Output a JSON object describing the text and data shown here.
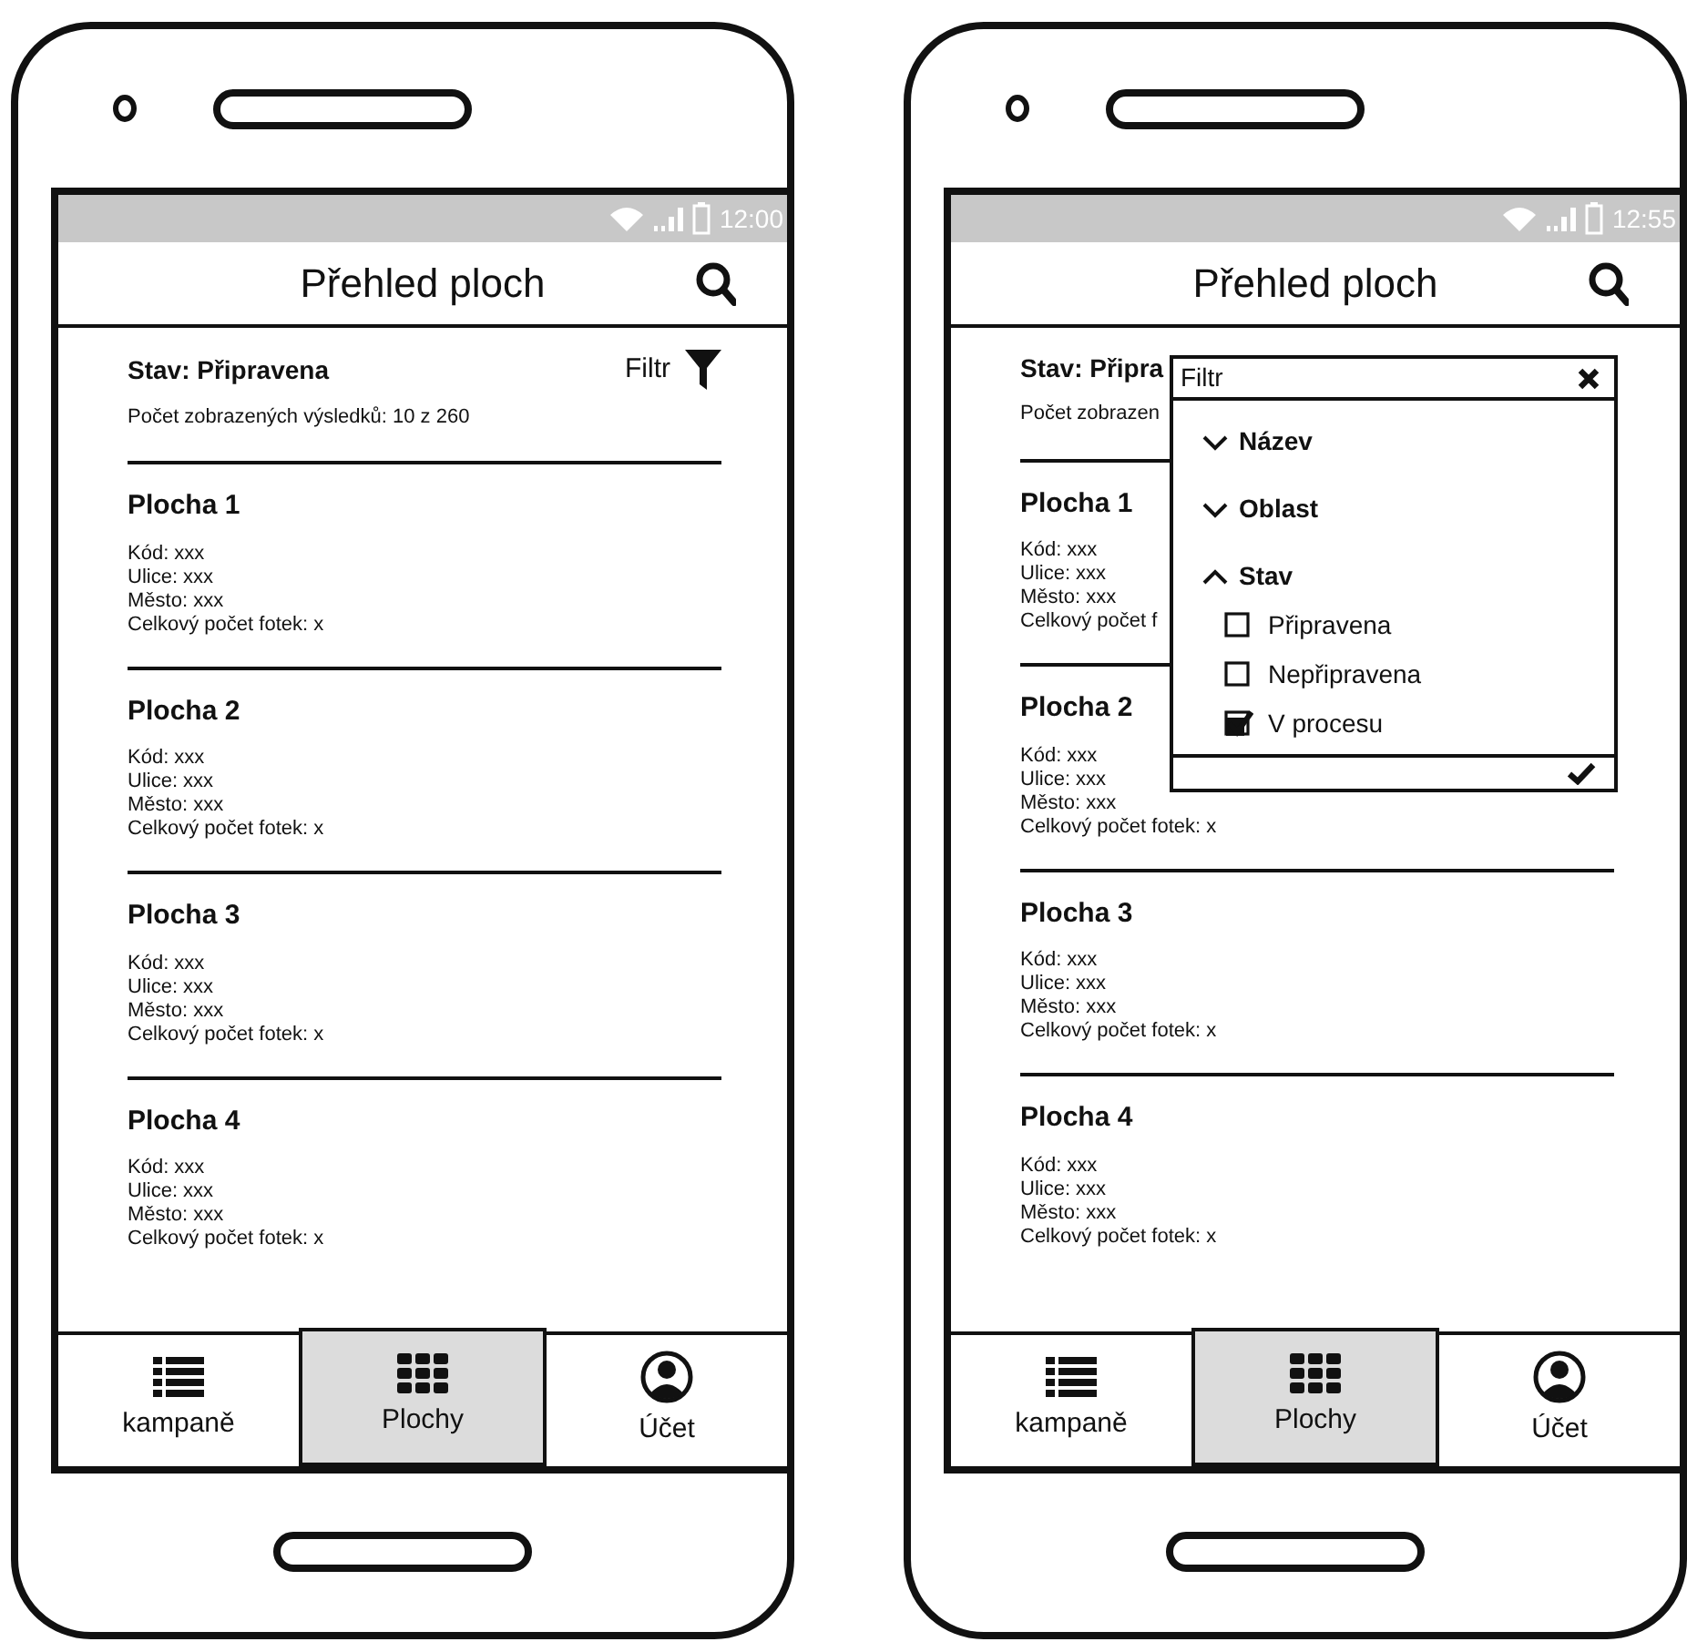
{
  "phones": [
    {
      "status_time": "12:00",
      "title": "Přehled ploch",
      "state_label": "Stav: Připravena",
      "filter_label": "Filtr",
      "count": "Počet zobrazených výsledků: 10 z 260",
      "items": [
        {
          "title": "Plocha 1",
          "lines": [
            "Kód: xxx",
            "Ulice: xxx",
            "Město: xxx",
            "Celkový počet fotek: x"
          ]
        },
        {
          "title": "Plocha 2",
          "lines": [
            "Kód: xxx",
            "Ulice: xxx",
            "Město: xxx",
            "Celkový počet fotek: x"
          ]
        },
        {
          "title": "Plocha 3",
          "lines": [
            "Kód: xxx",
            "Ulice: xxx",
            "Město: xxx",
            "Celkový počet fotek: x"
          ]
        },
        {
          "title": "Plocha 4",
          "lines": [
            "Kód: xxx",
            "Ulice: xxx",
            "Město: xxx",
            "Celkový počet fotek: x"
          ]
        }
      ],
      "nav": [
        {
          "label": "kampaně",
          "selected": false
        },
        {
          "label": "Plochy",
          "selected": true
        },
        {
          "label": "Účet",
          "selected": false
        }
      ]
    },
    {
      "status_time": "12:55",
      "title": "Přehled ploch",
      "state_label": "Stav: Připra",
      "count": "Počet zobrazen",
      "items": [
        {
          "title": "Plocha 1",
          "lines": [
            "Kód: xxx",
            "Ulice: xxx",
            "Město: xxx",
            "Celkový počet f"
          ]
        },
        {
          "title": "Plocha 2",
          "lines": [
            "Kód: xxx",
            "Ulice: xxx",
            "Město: xxx",
            "Celkový počet fotek: x"
          ]
        },
        {
          "title": "Plocha 3",
          "lines": [
            "Kód: xxx",
            "Ulice: xxx",
            "Město: xxx",
            "Celkový počet fotek: x"
          ]
        },
        {
          "title": "Plocha 4",
          "lines": [
            "Kód: xxx",
            "Ulice: xxx",
            "Město: xxx",
            "Celkový počet fotek: x"
          ]
        }
      ],
      "nav": [
        {
          "label": "kampaně",
          "selected": false
        },
        {
          "label": "Plochy",
          "selected": true
        },
        {
          "label": "Účet",
          "selected": false
        }
      ],
      "filter_panel": {
        "title": "Filtr",
        "sections": [
          {
            "label": "Název",
            "expanded": false
          },
          {
            "label": "Oblast",
            "expanded": false
          },
          {
            "label": "Stav",
            "expanded": true,
            "options": [
              {
                "label": "Připravena",
                "checked": false
              },
              {
                "label": "Nepřipravena",
                "checked": false
              },
              {
                "label": "V procesu",
                "checked": true
              }
            ]
          }
        ]
      }
    }
  ]
}
